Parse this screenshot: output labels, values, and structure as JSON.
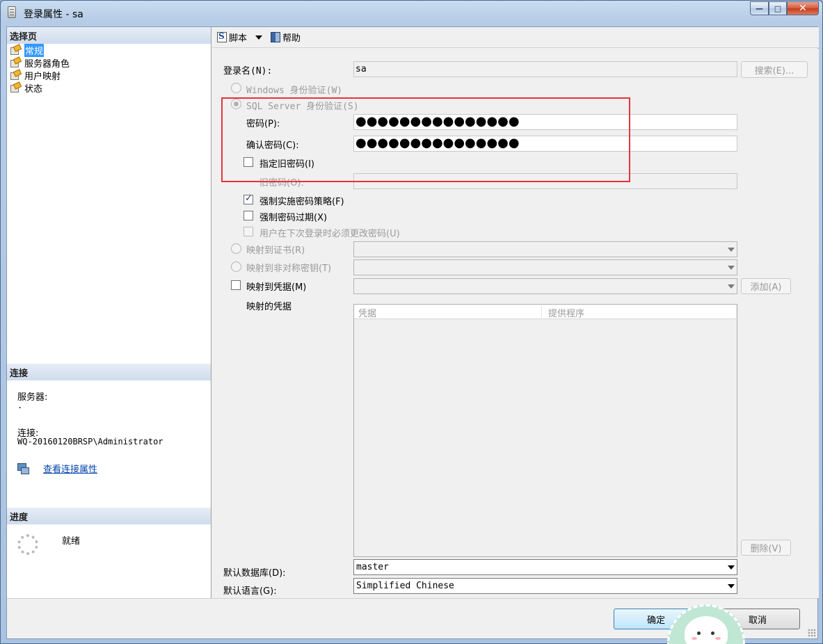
{
  "window": {
    "title": "登录属性 - sa",
    "minimize": "—",
    "maximize": "□",
    "close": "✕"
  },
  "left": {
    "select_page_header": "选择页",
    "nav_items": [
      {
        "label": "常规",
        "selected": true
      },
      {
        "label": "服务器角色",
        "selected": false
      },
      {
        "label": "用户映射",
        "selected": false
      },
      {
        "label": "状态",
        "selected": false
      }
    ],
    "connection_header": "连接",
    "server_label": "服务器:",
    "server_value": ".",
    "connection_label": "连接:",
    "connection_value": "WQ-20160120BRSP\\Administrator",
    "view_connection_link": "查看连接属性",
    "progress_header": "进度",
    "progress_status": "就绪"
  },
  "toolbar": {
    "script_label": "脚本",
    "help_label": "帮助"
  },
  "form": {
    "login_name_label": "登录名(N):",
    "login_name_value": "sa",
    "search_button": "搜索(E)...",
    "windows_auth_label": "Windows 身份验证(W)",
    "sql_auth_label": "SQL Server 身份验证(S)",
    "password_label": "密码(P):",
    "password_value": "●●●●●●●●●●●●●●●",
    "confirm_password_label": "确认密码(C):",
    "confirm_password_value": "●●●●●●●●●●●●●●●",
    "specify_old_password_label": "指定旧密码(I)",
    "old_password_label": "旧密码(O):",
    "enforce_policy_label": "强制实施密码策略(F)",
    "enforce_policy_checked": true,
    "enforce_expiration_label": "强制密码过期(X)",
    "must_change_label": "用户在下次登录时必须更改密码(U)",
    "map_certificate_label": "映射到证书(R)",
    "map_asymmetric_key_label": "映射到非对称密钥(T)",
    "map_credential_label": "映射到凭据(M)",
    "add_button": "添加(A)",
    "mapped_credentials_label": "映射的凭据",
    "grid_columns": [
      "凭据",
      "提供程序"
    ],
    "remove_button": "删除(V)",
    "default_database_label": "默认数据库(D):",
    "default_database_value": "master",
    "default_language_label": "默认语言(G):",
    "default_language_value": "Simplified Chinese"
  },
  "footer": {
    "ok_button": "确定",
    "cancel_button": "取消"
  },
  "colors": {
    "selection": "#3399ff",
    "annotation_box": "#e8323a",
    "link": "#0645ad"
  }
}
